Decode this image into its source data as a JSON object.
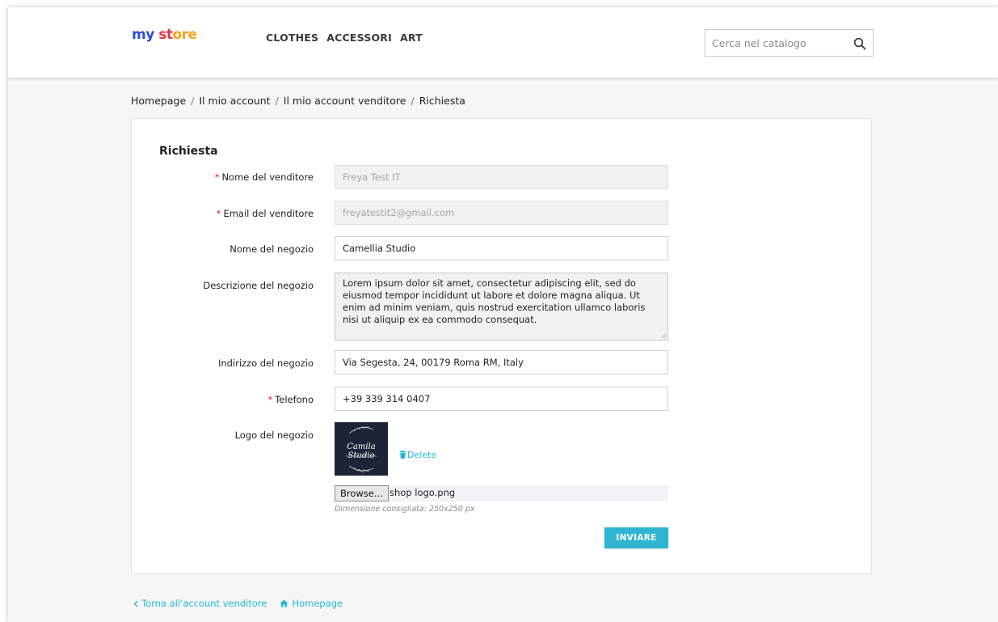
{
  "header": {
    "logo": {
      "part1": "my",
      "part2": " ",
      "part3": "st",
      "part4": "ore"
    },
    "nav": [
      "CLOTHES",
      "ACCESSORI",
      "ART"
    ],
    "search_placeholder": "Cerca nel catalogo",
    "search_icon": "search-icon"
  },
  "breadcrumb": [
    "Homepage",
    "Il mio account",
    "Il mio account venditore",
    "Richiesta"
  ],
  "form": {
    "title": "Richiesta",
    "required_mark": "*",
    "vendor_name": {
      "label": "Nome del venditore",
      "value": "Freya Test IT"
    },
    "vendor_email": {
      "label": "Email del venditore",
      "value": "freyatestit2@gmail.com"
    },
    "shop_name": {
      "label": "Nome del negozio",
      "value": "Camellia Studio"
    },
    "shop_description": {
      "label": "Descrizione del negozio",
      "value": "Lorem ipsum dolor sit amet, consectetur adipiscing elit, sed do eiusmod tempor incididunt ut labore et dolore magna aliqua. Ut enim ad minim veniam, quis nostrud exercitation ullamco laboris nisi ut aliquip ex ea commodo consequat."
    },
    "shop_address": {
      "label": "Indirizzo del negozio",
      "value": "Via Segesta, 24, 00179 Roma RM, Italy"
    },
    "phone": {
      "label": "Telefono",
      "value": "+39 339 314 0407"
    },
    "logo": {
      "label": "Logo del negozio",
      "image_text": "Camila Studio",
      "image_subtext": "URBAN CLOTHING",
      "delete_label": "Delete",
      "browse_label": "Browse...",
      "file_name": "shop logo.png",
      "hint": "Dimensione consigliata: 250x250 px"
    },
    "submit_label": "INVIARE"
  },
  "footer": {
    "back_label": "Torna all'account venditore",
    "home_label": "Homepage"
  },
  "colors": {
    "accent": "#2fb5d2",
    "required": "#e01e2b",
    "logo_bg": "#1d2437"
  }
}
